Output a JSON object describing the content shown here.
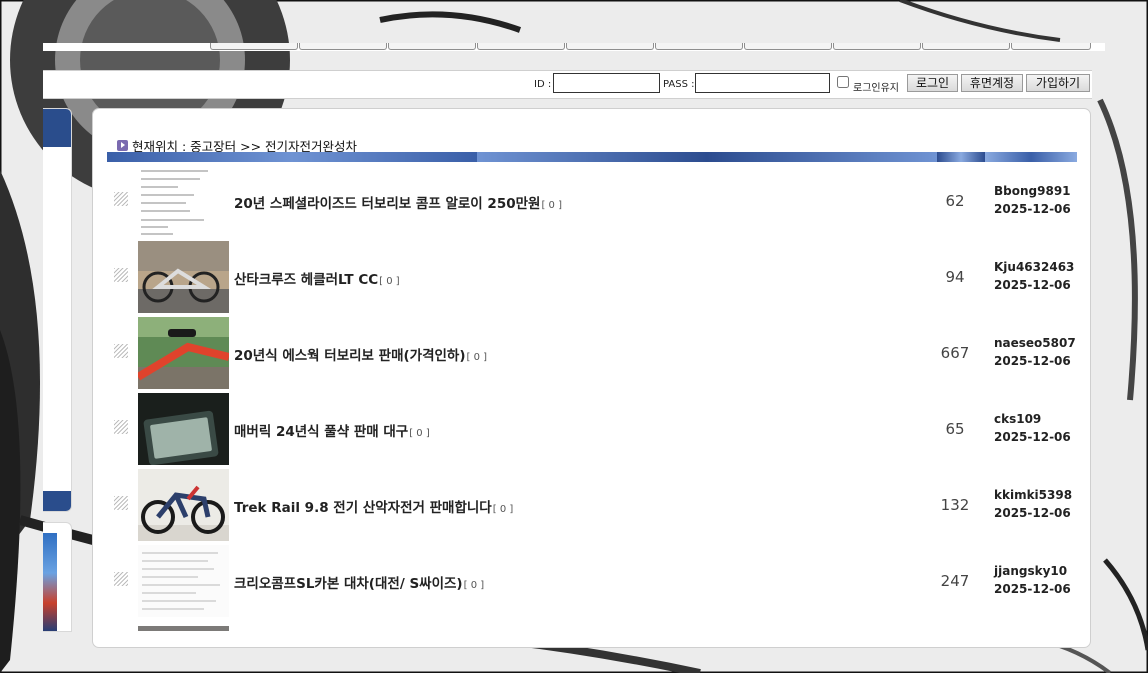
{
  "login": {
    "id_label": "ID :",
    "id_value": "",
    "pass_label": "PASS :",
    "pass_value": "",
    "keep_login_label": "로그인유지",
    "login_button": "로그인",
    "dormant_button": "휴면계정",
    "signup_button": "가입하기"
  },
  "board": {
    "breadcrumb": "현재위치 : 중고장터 >> 전기자전거완성차",
    "header_colors": [
      "#3a5fa8",
      "#6f93d3",
      "#2c4c8f",
      "#8aaae0"
    ],
    "posts": [
      {
        "title": "20년 스페셜라이즈드 터보리보 콤프 알로이 250만원",
        "comments": "[ 0 ]",
        "views": "62",
        "author": "Bbong9891",
        "date": "2025-12-06",
        "thumb": "document"
      },
      {
        "title": "산타크루즈 헤클러LT CC",
        "comments": "[ 0 ]",
        "views": "94",
        "author": "Kju4632463",
        "date": "2025-12-06",
        "thumb": "bike-shop"
      },
      {
        "title": "20년식 에스웍 터보리보 판매(가격인하)",
        "comments": "[ 0 ]",
        "views": "667",
        "author": "naeseo5807",
        "date": "2025-12-06",
        "thumb": "red-bike"
      },
      {
        "title": "매버릭 24년식 풀샥 판매 대구",
        "comments": "[ 0 ]",
        "views": "65",
        "author": "cks109",
        "date": "2025-12-06",
        "thumb": "display"
      },
      {
        "title": "Trek Rail 9.8 전기 산악자전거 판매합니다",
        "comments": "[ 0 ]",
        "views": "132",
        "author": "kkimki5398",
        "date": "2025-12-06",
        "thumb": "trek-bike"
      },
      {
        "title": "크리오콤프SL카본 대차(대전/ S싸이즈)",
        "comments": "[ 0 ]",
        "views": "247",
        "author": "jjangsky10",
        "date": "2025-12-06",
        "thumb": "document-2"
      }
    ]
  }
}
